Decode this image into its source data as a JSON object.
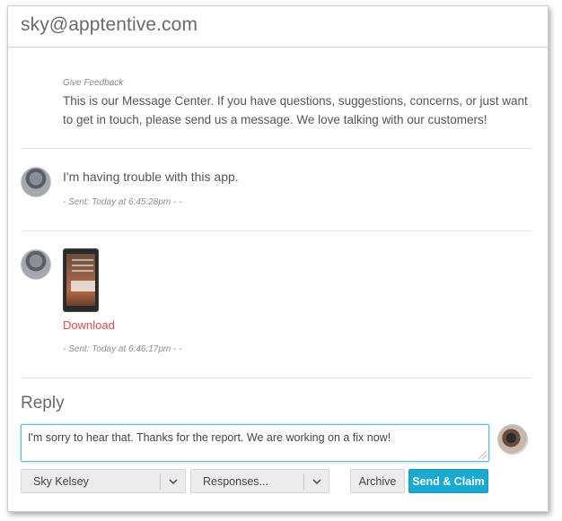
{
  "header": {
    "email": "sky@apptentive.com"
  },
  "intro": {
    "label": "Give Feedback",
    "text": "This is our Message Center. If you have questions, suggestions, concerns, or just want to get in touch, please send us a message. We love talking with our customers!"
  },
  "messages": [
    {
      "text": "I'm having trouble with this app.",
      "meta": "- Sent: Today at 6:45:28pm - -"
    },
    {
      "attachment_link": "Download",
      "meta": "- Sent: Today at 6:46:17pm - -"
    }
  ],
  "reply": {
    "title": "Reply",
    "value": "I'm sorry to hear that. Thanks for the report. We are working on a fix now!"
  },
  "controls": {
    "assignee_selected": "Sky Kelsey",
    "responses_selected": "Responses...",
    "archive_label": "Archive",
    "send_label": "Send & Claim"
  },
  "colors": {
    "accent": "#18a9d4",
    "link": "#e24b4b",
    "focus": "#5fb6d8"
  },
  "icons": [
    "user-avatar-icon",
    "agent-avatar-icon",
    "chevron-down-icon",
    "resize-handle-icon"
  ]
}
